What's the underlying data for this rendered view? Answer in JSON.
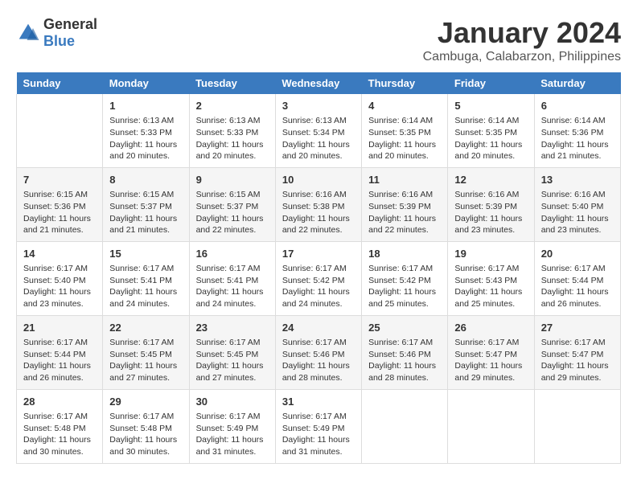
{
  "logo": {
    "general": "General",
    "blue": "Blue"
  },
  "header": {
    "title": "January 2024",
    "subtitle": "Cambuga, Calabarzon, Philippines"
  },
  "days_of_week": [
    "Sunday",
    "Monday",
    "Tuesday",
    "Wednesday",
    "Thursday",
    "Friday",
    "Saturday"
  ],
  "weeks": [
    [
      {
        "day": "",
        "sunrise": "",
        "sunset": "",
        "daylight": ""
      },
      {
        "day": "1",
        "sunrise": "Sunrise: 6:13 AM",
        "sunset": "Sunset: 5:33 PM",
        "daylight": "Daylight: 11 hours and 20 minutes."
      },
      {
        "day": "2",
        "sunrise": "Sunrise: 6:13 AM",
        "sunset": "Sunset: 5:33 PM",
        "daylight": "Daylight: 11 hours and 20 minutes."
      },
      {
        "day": "3",
        "sunrise": "Sunrise: 6:13 AM",
        "sunset": "Sunset: 5:34 PM",
        "daylight": "Daylight: 11 hours and 20 minutes."
      },
      {
        "day": "4",
        "sunrise": "Sunrise: 6:14 AM",
        "sunset": "Sunset: 5:35 PM",
        "daylight": "Daylight: 11 hours and 20 minutes."
      },
      {
        "day": "5",
        "sunrise": "Sunrise: 6:14 AM",
        "sunset": "Sunset: 5:35 PM",
        "daylight": "Daylight: 11 hours and 20 minutes."
      },
      {
        "day": "6",
        "sunrise": "Sunrise: 6:14 AM",
        "sunset": "Sunset: 5:36 PM",
        "daylight": "Daylight: 11 hours and 21 minutes."
      }
    ],
    [
      {
        "day": "7",
        "sunrise": "Sunrise: 6:15 AM",
        "sunset": "Sunset: 5:36 PM",
        "daylight": "Daylight: 11 hours and 21 minutes."
      },
      {
        "day": "8",
        "sunrise": "Sunrise: 6:15 AM",
        "sunset": "Sunset: 5:37 PM",
        "daylight": "Daylight: 11 hours and 21 minutes."
      },
      {
        "day": "9",
        "sunrise": "Sunrise: 6:15 AM",
        "sunset": "Sunset: 5:37 PM",
        "daylight": "Daylight: 11 hours and 22 minutes."
      },
      {
        "day": "10",
        "sunrise": "Sunrise: 6:16 AM",
        "sunset": "Sunset: 5:38 PM",
        "daylight": "Daylight: 11 hours and 22 minutes."
      },
      {
        "day": "11",
        "sunrise": "Sunrise: 6:16 AM",
        "sunset": "Sunset: 5:39 PM",
        "daylight": "Daylight: 11 hours and 22 minutes."
      },
      {
        "day": "12",
        "sunrise": "Sunrise: 6:16 AM",
        "sunset": "Sunset: 5:39 PM",
        "daylight": "Daylight: 11 hours and 23 minutes."
      },
      {
        "day": "13",
        "sunrise": "Sunrise: 6:16 AM",
        "sunset": "Sunset: 5:40 PM",
        "daylight": "Daylight: 11 hours and 23 minutes."
      }
    ],
    [
      {
        "day": "14",
        "sunrise": "Sunrise: 6:17 AM",
        "sunset": "Sunset: 5:40 PM",
        "daylight": "Daylight: 11 hours and 23 minutes."
      },
      {
        "day": "15",
        "sunrise": "Sunrise: 6:17 AM",
        "sunset": "Sunset: 5:41 PM",
        "daylight": "Daylight: 11 hours and 24 minutes."
      },
      {
        "day": "16",
        "sunrise": "Sunrise: 6:17 AM",
        "sunset": "Sunset: 5:41 PM",
        "daylight": "Daylight: 11 hours and 24 minutes."
      },
      {
        "day": "17",
        "sunrise": "Sunrise: 6:17 AM",
        "sunset": "Sunset: 5:42 PM",
        "daylight": "Daylight: 11 hours and 24 minutes."
      },
      {
        "day": "18",
        "sunrise": "Sunrise: 6:17 AM",
        "sunset": "Sunset: 5:42 PM",
        "daylight": "Daylight: 11 hours and 25 minutes."
      },
      {
        "day": "19",
        "sunrise": "Sunrise: 6:17 AM",
        "sunset": "Sunset: 5:43 PM",
        "daylight": "Daylight: 11 hours and 25 minutes."
      },
      {
        "day": "20",
        "sunrise": "Sunrise: 6:17 AM",
        "sunset": "Sunset: 5:44 PM",
        "daylight": "Daylight: 11 hours and 26 minutes."
      }
    ],
    [
      {
        "day": "21",
        "sunrise": "Sunrise: 6:17 AM",
        "sunset": "Sunset: 5:44 PM",
        "daylight": "Daylight: 11 hours and 26 minutes."
      },
      {
        "day": "22",
        "sunrise": "Sunrise: 6:17 AM",
        "sunset": "Sunset: 5:45 PM",
        "daylight": "Daylight: 11 hours and 27 minutes."
      },
      {
        "day": "23",
        "sunrise": "Sunrise: 6:17 AM",
        "sunset": "Sunset: 5:45 PM",
        "daylight": "Daylight: 11 hours and 27 minutes."
      },
      {
        "day": "24",
        "sunrise": "Sunrise: 6:17 AM",
        "sunset": "Sunset: 5:46 PM",
        "daylight": "Daylight: 11 hours and 28 minutes."
      },
      {
        "day": "25",
        "sunrise": "Sunrise: 6:17 AM",
        "sunset": "Sunset: 5:46 PM",
        "daylight": "Daylight: 11 hours and 28 minutes."
      },
      {
        "day": "26",
        "sunrise": "Sunrise: 6:17 AM",
        "sunset": "Sunset: 5:47 PM",
        "daylight": "Daylight: 11 hours and 29 minutes."
      },
      {
        "day": "27",
        "sunrise": "Sunrise: 6:17 AM",
        "sunset": "Sunset: 5:47 PM",
        "daylight": "Daylight: 11 hours and 29 minutes."
      }
    ],
    [
      {
        "day": "28",
        "sunrise": "Sunrise: 6:17 AM",
        "sunset": "Sunset: 5:48 PM",
        "daylight": "Daylight: 11 hours and 30 minutes."
      },
      {
        "day": "29",
        "sunrise": "Sunrise: 6:17 AM",
        "sunset": "Sunset: 5:48 PM",
        "daylight": "Daylight: 11 hours and 30 minutes."
      },
      {
        "day": "30",
        "sunrise": "Sunrise: 6:17 AM",
        "sunset": "Sunset: 5:49 PM",
        "daylight": "Daylight: 11 hours and 31 minutes."
      },
      {
        "day": "31",
        "sunrise": "Sunrise: 6:17 AM",
        "sunset": "Sunset: 5:49 PM",
        "daylight": "Daylight: 11 hours and 31 minutes."
      },
      {
        "day": "",
        "sunrise": "",
        "sunset": "",
        "daylight": ""
      },
      {
        "day": "",
        "sunrise": "",
        "sunset": "",
        "daylight": ""
      },
      {
        "day": "",
        "sunrise": "",
        "sunset": "",
        "daylight": ""
      }
    ]
  ]
}
